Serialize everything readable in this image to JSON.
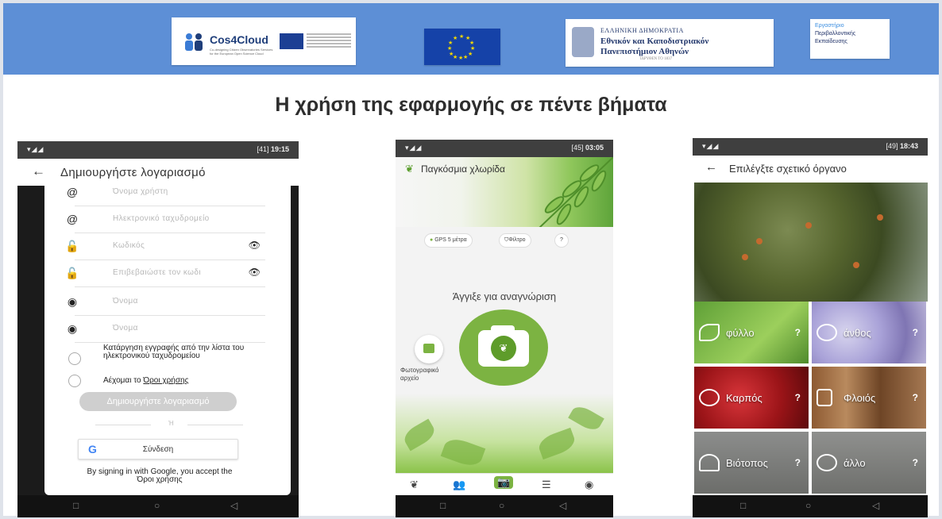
{
  "banner": {
    "cos4cloud": "Cos4Cloud",
    "cos4cloud_sub": "Co-designing Citizen Observatories Services for the European Open Science Cloud",
    "uoa_line1": "ΕΛΛΗΝΙΚΗ ΔΗΜΟΚΡΑΤΙΑ",
    "uoa_line2": "Εθνικόν και Καποδιστριακόν",
    "uoa_line3": "Πανεπιστήμιον Αθηνών",
    "uoa_line4": "ΙΔΡΥΘΕΝ ΤΟ 1837",
    "lab_line1": "Εργαστήριο",
    "lab_line2": "Περιβαλλοντικής",
    "lab_line3": "Εκπαίδευσης"
  },
  "slide_title": "Η χρήση της εφαρμογής σε πέντε βήματα",
  "phone1": {
    "time": "19:15",
    "signal": "▾◢◢",
    "battery": "[41]",
    "title": "Δημιουργήστε λογαριασμό",
    "fields": [
      {
        "icon": "@",
        "placeholder": "Όνομα χρήστη"
      },
      {
        "icon": "@",
        "placeholder": "Ηλεκτρονικό ταχυδρομείο"
      },
      {
        "icon": "🔓",
        "placeholder": "Κωδικός"
      },
      {
        "icon": "🔓",
        "placeholder": "Επιβεβαιώστε τον κωδι"
      },
      {
        "icon": "◉",
        "placeholder": "Όνομα"
      },
      {
        "icon": "◉",
        "placeholder": "Όνομα"
      }
    ],
    "unsubscribe_label": "Κατάργηση εγγραφής από την λίστα του ηλεκτρονικού ταχυδρομείου",
    "accept_prefix": "Αέχομαι το",
    "accept_link": "Όροι χρήσης",
    "create_button": "Δημιουργήστε λογαριασμό",
    "or_text": "Ή",
    "google_button": "Σύνδεση",
    "terms_text": "By signing in with Google, you accept the",
    "terms_link": "Όροι χρήσης",
    "nav_back": "◁",
    "nav_home": "○",
    "nav_recent": "□"
  },
  "phone2": {
    "time": "03:05",
    "signal": "▾◢◢",
    "battery": "[45]",
    "title": "Παγκόσμια χλωρίδα",
    "gps_chip": "GPS 5 μέτρα",
    "filter_chip": "Φίλτρο",
    "help_chip": "?",
    "touch_text": "Άγγιξε για αναγνώριση",
    "gallery_label": "Φωτογραφικό αρχείο",
    "nav_back": "◁",
    "nav_home": "○",
    "nav_recent": "□"
  },
  "phone3": {
    "time": "18:43",
    "signal": "▾◢◢",
    "battery": "[49]",
    "title": "Επιλέγξτε σχετικό όργανο",
    "organs": {
      "leaf": "φύλλο",
      "flower": "άνθος",
      "fruit": "Καρπός",
      "bark": "Φλοιός",
      "habitat": "Βιότοπος",
      "other": "άλλο"
    },
    "help": "?",
    "nav_back": "◁",
    "nav_home": "○",
    "nav_recent": "□"
  },
  "colors": {
    "banner": "#5d8fd6",
    "accent_green": "#7cb342",
    "statusbar": "#3f3f3f"
  }
}
